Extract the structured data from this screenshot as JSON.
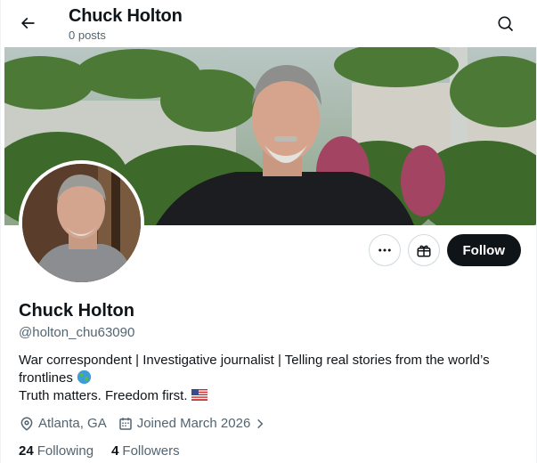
{
  "header": {
    "title": "Chuck Holton",
    "post_count": "0 posts"
  },
  "icons": {
    "back": "arrow-left-icon",
    "search": "search-icon",
    "more": "more-dots-icon",
    "gift": "gift-icon",
    "location": "location-pin-icon",
    "calendar": "calendar-icon",
    "globe": "globe-emoji",
    "flag": "us-flag-emoji"
  },
  "actions": {
    "follow_label": "Follow"
  },
  "profile": {
    "name": "Chuck Holton",
    "handle": "@holton_chu63090",
    "bio_line1": "War correspondent | Investigative journalist | Telling real stories from the world’s",
    "bio_line2": "frontlines",
    "bio_line3": "Truth matters. Freedom first.",
    "location": "Atlanta, GA",
    "joined": "Joined March 2026",
    "following_count": "24",
    "following_label": "Following",
    "followers_count": "4",
    "followers_label": "Followers"
  },
  "colors": {
    "text": "#0f1419",
    "secondary": "#536471",
    "follow_bg": "#0f1419",
    "border": "#cfd9de"
  }
}
